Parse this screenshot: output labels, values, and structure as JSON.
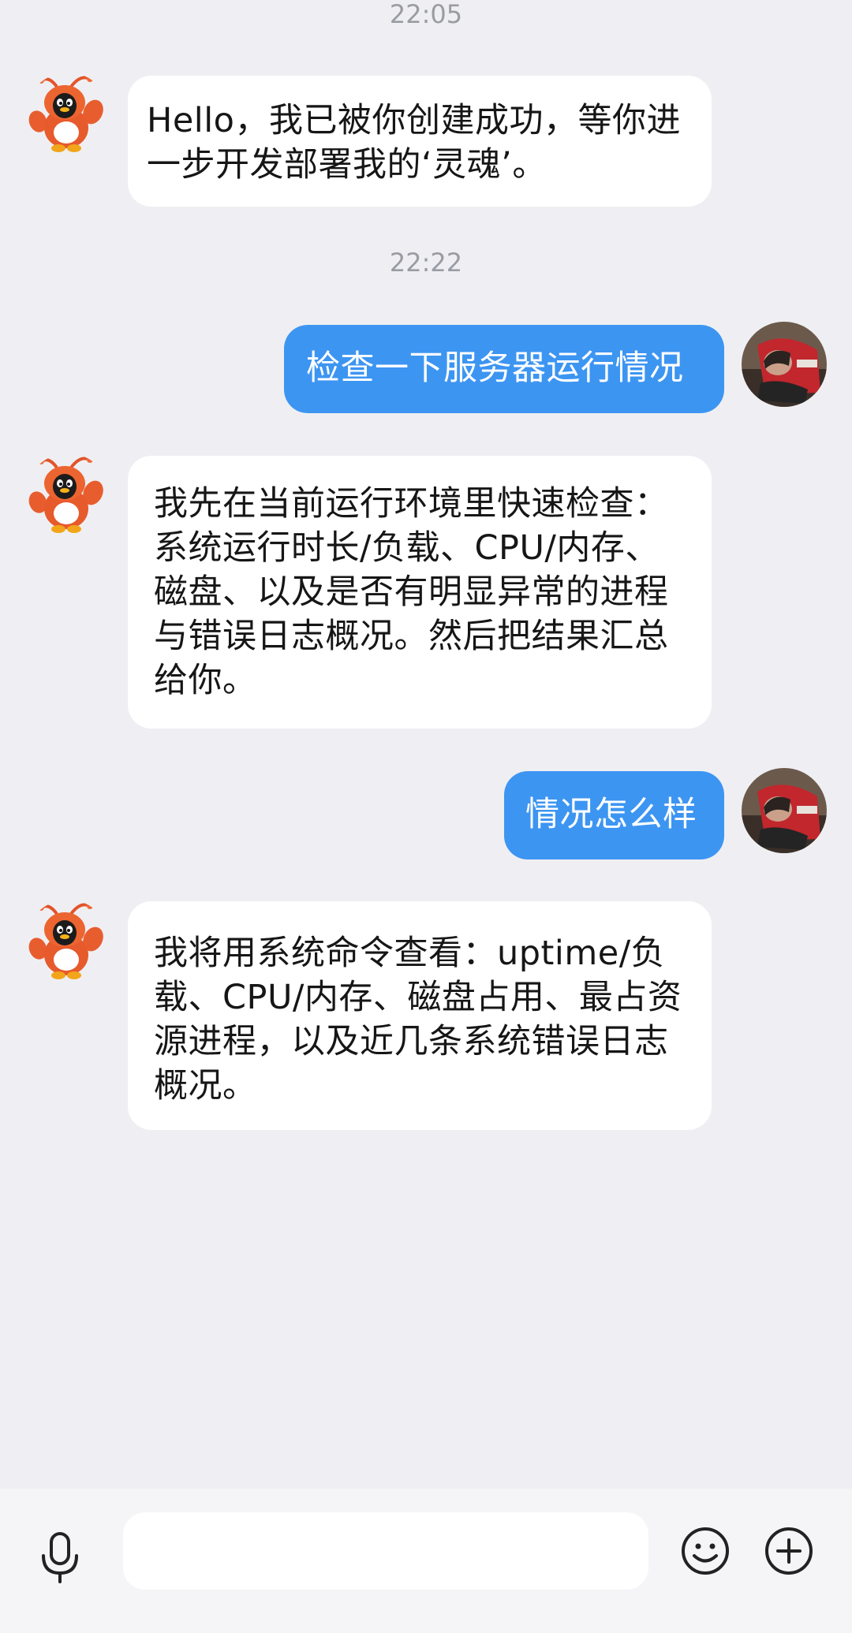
{
  "timestamps": [
    "22:05",
    "22:22"
  ],
  "messages": [
    {
      "sender": "bot",
      "text": "Hello，我已被你创建成功，等你进一步开发部署我的‘灵魂’。",
      "avatar": "lobster-penguin-avatar"
    },
    {
      "sender": "user",
      "text": "检查一下服务器运行情况",
      "avatar": "user-photo-avatar"
    },
    {
      "sender": "bot",
      "text": "我先在当前运行环境里快速检查：系统运行时长/负载、CPU/内存、磁盘、以及是否有明显异常的进程与错误日志概况。然后把结果汇总给你。",
      "avatar": "lobster-penguin-avatar"
    },
    {
      "sender": "user",
      "text": "情况怎么样",
      "avatar": "user-photo-avatar"
    },
    {
      "sender": "bot",
      "text": "我将用系统命令查看：uptime/负载、CPU/内存、磁盘占用、最占资源进程，以及近几条系统错误日志概况。",
      "avatar": "lobster-penguin-avatar"
    }
  ],
  "input_bar": {
    "value": "",
    "icons": [
      "microphone-icon",
      "emoji-icon",
      "plus-icon"
    ]
  },
  "colors": {
    "background": "#efeff3",
    "bot_bubble": "#ffffff",
    "user_bubble": "#3d95f2",
    "timestamp_text": "#9a9ca3",
    "mascot_orange": "#e25a2b"
  }
}
